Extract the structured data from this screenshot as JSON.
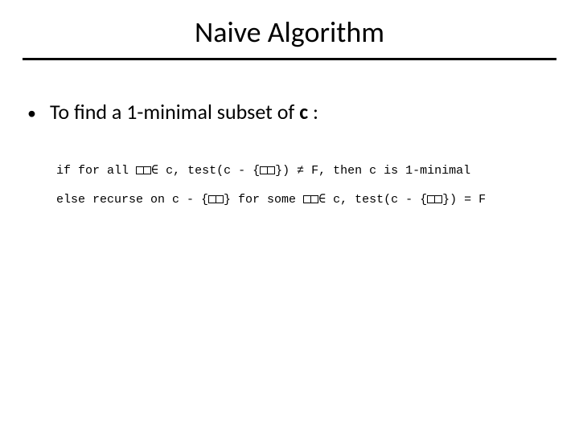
{
  "title": "Naive Algorithm",
  "bullet": {
    "dot": "•",
    "text_prefix": "To find a 1-minimal subset of ",
    "var": "c",
    "text_suffix": " :"
  },
  "code": {
    "line1": {
      "t1": "if for all ",
      "t2": " c, test(c - {",
      "t3": "}) ≠ F, then c is 1-minimal"
    },
    "line2": {
      "t1": "else recurse on c - {",
      "t2": "} for some ",
      "t3": " c, test(c - {",
      "t4": "}) = F"
    }
  }
}
